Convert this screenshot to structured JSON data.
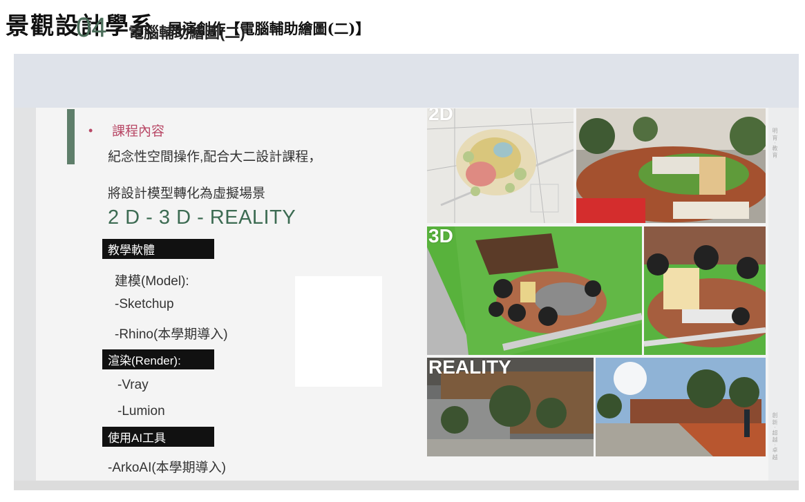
{
  "page": {
    "department_title": "景觀設計學系",
    "course_title": "展演創作【電腦輔助繪圖(二)】"
  },
  "slide": {
    "section_number": "04",
    "section_title": "電腦輔助繪圖(二)",
    "bullet_title": "課程內容",
    "line1": "紀念性空間操作,配合大二設計課程，",
    "line2": "將設計模型轉化為虛擬場景",
    "tagline": "2 D  -  3 D  - REALITY",
    "teaching_software": {
      "label": "教學軟體",
      "items": [
        "建模(Model):",
        "-Sketchup",
        "-Rhino(本學期導入)"
      ]
    },
    "render": {
      "label": "渲染(Render):",
      "items": [
        "-Vray",
        "-Lumion"
      ]
    },
    "ai_tools": {
      "label": "使用AI工具",
      "items": [
        "-ArkoAI(本學期導入)"
      ]
    },
    "image_labels": {
      "two_d": "2D",
      "three_d": "3D",
      "reality": "REALITY"
    },
    "side_text_top": "明 育 · 教 育",
    "side_text_bottom": "創 新 · 超 越 · 卓 越"
  },
  "colors": {
    "accent_green": "#4b6e5a",
    "bullet_pink": "#b84866",
    "label_black": "#111111"
  }
}
